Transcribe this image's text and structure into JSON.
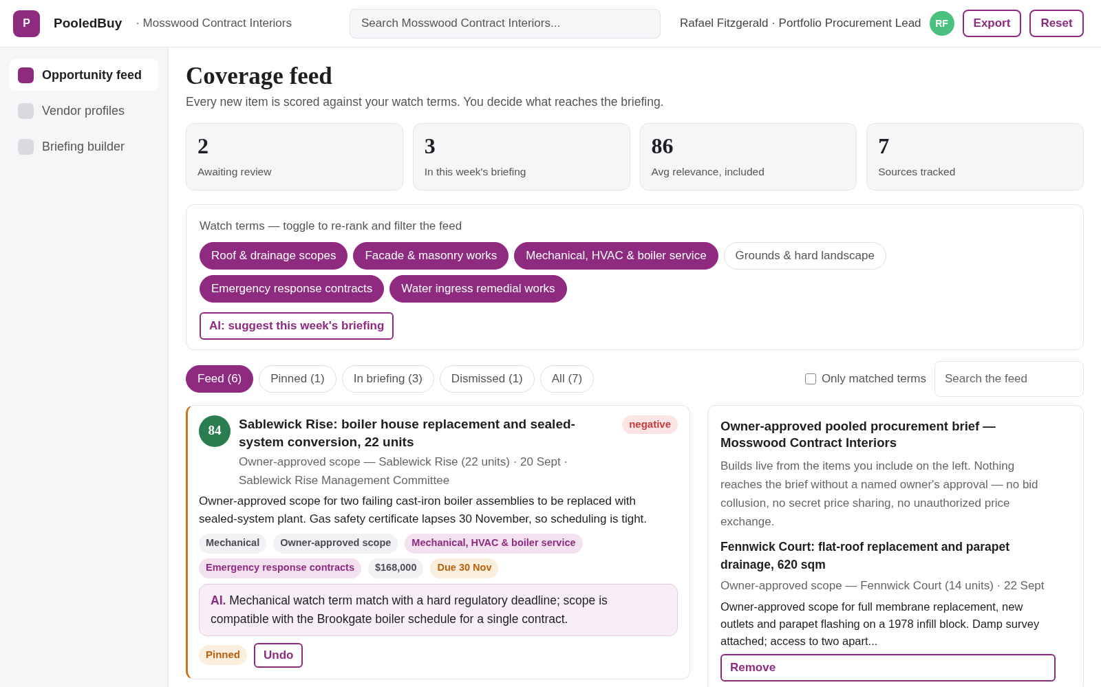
{
  "header": {
    "logo_letter": "P",
    "app_name": "PooledBuy",
    "org": "· Mosswood Contract Interiors",
    "search": {
      "placeholder": "Search Mosswood Contract Interiors..."
    },
    "user": "Rafael Fitzgerald · Portfolio Procurement Lead",
    "avatar": "RF",
    "buttons": [
      "Export",
      "Reset"
    ]
  },
  "sidebar": {
    "items": [
      {
        "label": "Opportunity feed",
        "selected": true
      },
      {
        "label": "Vendor profiles",
        "selected": false
      },
      {
        "label": "Briefing builder",
        "selected": false
      }
    ]
  },
  "page": {
    "title": "Coverage feed",
    "subtitle": "Every new item is scored against your watch terms. You decide what reaches the briefing."
  },
  "stats": [
    {
      "value": "2",
      "label": "Awaiting review"
    },
    {
      "value": "3",
      "label": "In this week's briefing"
    },
    {
      "value": "86",
      "label": "Avg relevance, included"
    },
    {
      "value": "7",
      "label": "Sources tracked"
    }
  ],
  "watch_terms": {
    "label": "Watch terms — toggle to re-rank and filter the feed",
    "terms": [
      {
        "label": "Roof & drainage scopes",
        "on": true
      },
      {
        "label": "Facade & masonry works",
        "on": true
      },
      {
        "label": "Mechanical, HVAC & boiler service",
        "on": true
      },
      {
        "label": "Grounds & hard landscape",
        "on": false
      },
      {
        "label": "Emergency response contracts",
        "on": true
      },
      {
        "label": "Water ingress remedial works",
        "on": true
      }
    ],
    "ai_button": "AI: suggest this week's briefing"
  },
  "tabs": [
    {
      "label": "Feed (6)",
      "selected": true
    },
    {
      "label": "Pinned (1)",
      "selected": false
    },
    {
      "label": "In briefing (3)",
      "selected": false
    },
    {
      "label": "Dismissed (1)",
      "selected": false
    },
    {
      "label": "All (7)",
      "selected": false
    }
  ],
  "only_matched": {
    "label": "Only matched terms",
    "checked": false
  },
  "feed_search": {
    "placeholder": "Search the feed"
  },
  "feed_item": {
    "score": "84",
    "title": "Sablewick Rise: boiler house replacement and sealed-system conversion, 22 units",
    "sentiment": "negative",
    "meta": "Owner-approved scope — Sablewick Rise (22 units) · 20 Sept · Sablewick Rise Management Committee",
    "body": "Owner-approved scope for two failing cast-iron boiler assemblies to be replaced with sealed-system plant. Gas safety certificate lapses 30 November, so scheduling is tight.",
    "tags": [
      {
        "label": "Mechanical",
        "kind": "neutral"
      },
      {
        "label": "Owner-approved scope",
        "kind": "neutral"
      },
      {
        "label": "Mechanical, HVAC & boiler service",
        "kind": "term"
      },
      {
        "label": "Emergency response contracts",
        "kind": "term"
      },
      {
        "label": "$168,000",
        "kind": "neutral"
      },
      {
        "label": "Due 30 Nov",
        "kind": "due"
      }
    ],
    "ai_note": "**AI.** Mechanical watch term match with a hard regulatory deadline; scope is compatible with the Brookgate boiler schedule for a single contract.",
    "status": "Pinned",
    "undo_button": "Undo"
  },
  "brief": {
    "title": "Owner-approved pooled procurement brief — Mosswood Contract Interiors",
    "intro": "Builds live from the items you include on the left. Nothing reaches the brief without a named owner's approval — no bid collusion, no secret price sharing, no unauthorized price exchange.",
    "items": [
      {
        "title": "Fennwick Court: flat-roof replacement and parapet drainage, 620 sqm",
        "meta": "Owner-approved scope — Fennwick Court (14 units) · 22 Sept",
        "body": "Owner-approved scope for full membrane replacement, new outlets and parapet flashing on a 1978 infill block. Damp survey attached; access to two apart...",
        "button": "Remove"
      }
    ]
  }
}
